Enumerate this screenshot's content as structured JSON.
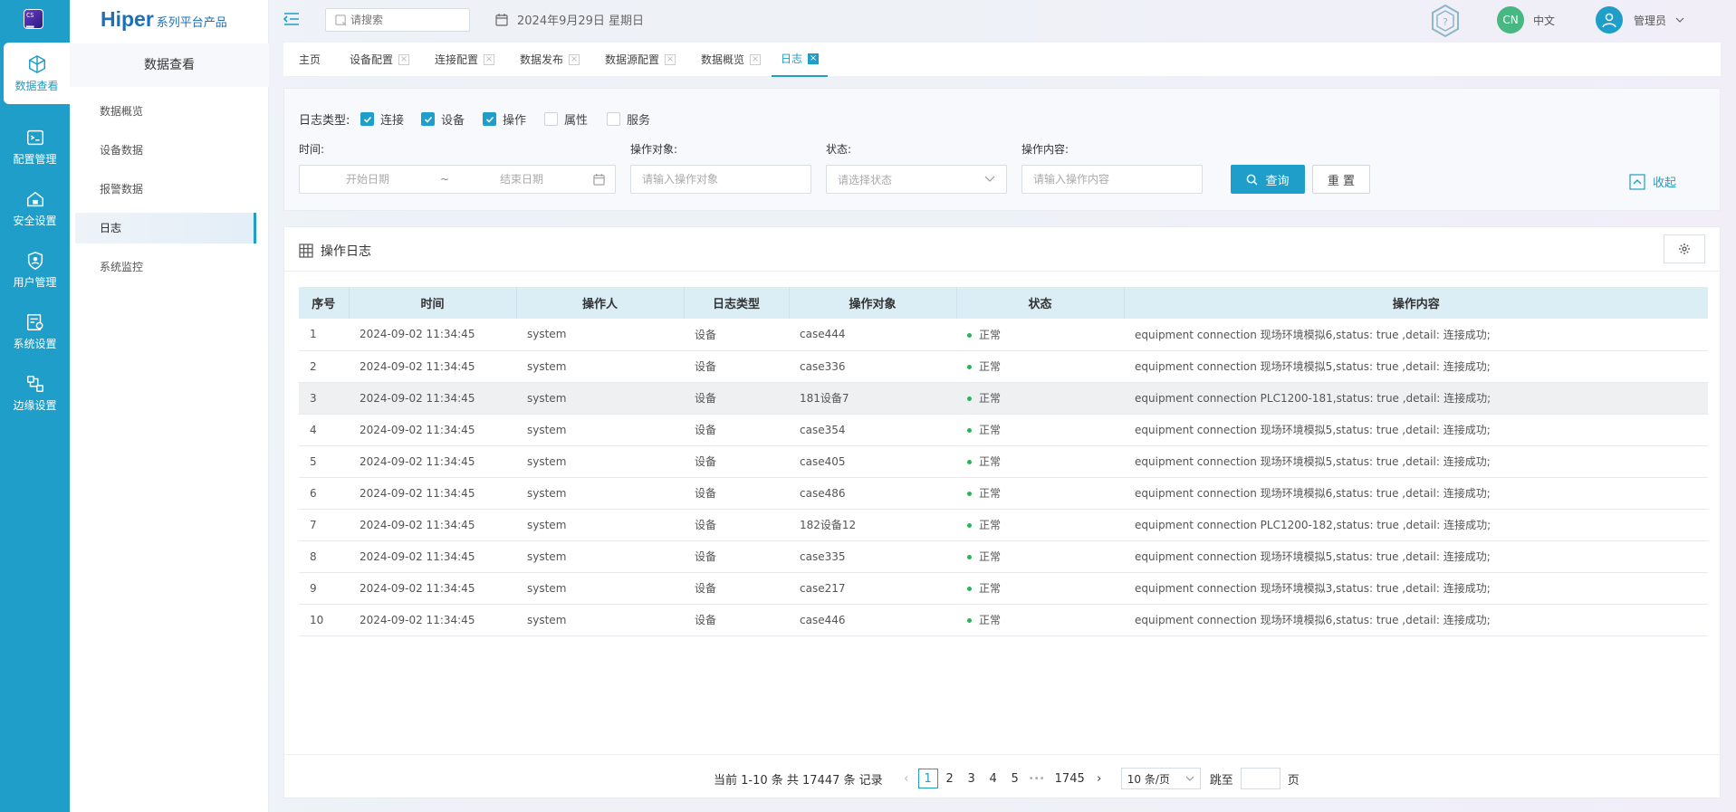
{
  "rail": {
    "items": [
      {
        "label": "数据查看",
        "icon": "cube-icon"
      },
      {
        "label": "配置管理",
        "icon": "cli-icon"
      },
      {
        "label": "安全设置",
        "icon": "house-lock-icon"
      },
      {
        "label": "用户管理",
        "icon": "shield-user-icon"
      },
      {
        "label": "系统设置",
        "icon": "settings-panel-icon"
      },
      {
        "label": "边缘设置",
        "icon": "edge-nodes-icon"
      }
    ]
  },
  "brand": {
    "name": "Hiper",
    "subtitle": "系列平台产品"
  },
  "sidebar": {
    "title": "数据查看",
    "items": [
      {
        "label": "数据概览"
      },
      {
        "label": "设备数据"
      },
      {
        "label": "报警数据"
      },
      {
        "label": "日志"
      },
      {
        "label": "系统监控"
      }
    ]
  },
  "header": {
    "search_placeholder": "请搜索",
    "date": "2024年9月29日 星期日",
    "lang_badge": "CN",
    "lang_label": "中文",
    "user": "管理员"
  },
  "tabs": [
    {
      "label": "主页"
    },
    {
      "label": "设备配置"
    },
    {
      "label": "连接配置"
    },
    {
      "label": "数据发布"
    },
    {
      "label": "数据源配置"
    },
    {
      "label": "数据概览"
    },
    {
      "label": "日志"
    }
  ],
  "filter": {
    "log_type_label": "日志类型:",
    "log_types": [
      {
        "label": "连接",
        "checked": true
      },
      {
        "label": "设备",
        "checked": true
      },
      {
        "label": "操作",
        "checked": true
      },
      {
        "label": "属性",
        "checked": false
      },
      {
        "label": "服务",
        "checked": false
      }
    ],
    "time_label": "时间:",
    "start_placeholder": "开始日期",
    "range_sep": "~",
    "end_placeholder": "结束日期",
    "target_label": "操作对象:",
    "target_placeholder": "请输入操作对象",
    "status_label": "状态:",
    "status_placeholder": "请选择状态",
    "content_label": "操作内容:",
    "content_placeholder": "请输入操作内容",
    "query_btn": "查询",
    "reset_btn": "重 置",
    "collapse": "收起"
  },
  "table": {
    "title": "操作日志",
    "columns": [
      "序号",
      "时间",
      "操作人",
      "日志类型",
      "操作对象",
      "状态",
      "操作内容"
    ],
    "rows": [
      [
        "1",
        "2024-09-02 11:34:45",
        "system",
        "设备",
        "case444",
        "正常",
        "equipment connection 现场环境模拟6,status: true ,detail: 连接成功;"
      ],
      [
        "2",
        "2024-09-02 11:34:45",
        "system",
        "设备",
        "case336",
        "正常",
        "equipment connection 现场环境模拟5,status: true ,detail: 连接成功;"
      ],
      [
        "3",
        "2024-09-02 11:34:45",
        "system",
        "设备",
        "181设备7",
        "正常",
        "equipment connection PLC1200-181,status: true ,detail: 连接成功;"
      ],
      [
        "4",
        "2024-09-02 11:34:45",
        "system",
        "设备",
        "case354",
        "正常",
        "equipment connection 现场环境模拟5,status: true ,detail: 连接成功;"
      ],
      [
        "5",
        "2024-09-02 11:34:45",
        "system",
        "设备",
        "case405",
        "正常",
        "equipment connection 现场环境模拟5,status: true ,detail: 连接成功;"
      ],
      [
        "6",
        "2024-09-02 11:34:45",
        "system",
        "设备",
        "case486",
        "正常",
        "equipment connection 现场环境模拟6,status: true ,detail: 连接成功;"
      ],
      [
        "7",
        "2024-09-02 11:34:45",
        "system",
        "设备",
        "182设备12",
        "正常",
        "equipment connection PLC1200-182,status: true ,detail: 连接成功;"
      ],
      [
        "8",
        "2024-09-02 11:34:45",
        "system",
        "设备",
        "case335",
        "正常",
        "equipment connection 现场环境模拟5,status: true ,detail: 连接成功;"
      ],
      [
        "9",
        "2024-09-02 11:34:45",
        "system",
        "设备",
        "case217",
        "正常",
        "equipment connection 现场环境模拟3,status: true ,detail: 连接成功;"
      ],
      [
        "10",
        "2024-09-02 11:34:45",
        "system",
        "设备",
        "case446",
        "正常",
        "equipment connection 现场环境模拟6,status: true ,detail: 连接成功;"
      ]
    ],
    "highlighted_row": 3
  },
  "pagination": {
    "summary": "当前 1-10 条 共 17447 条 记录",
    "pages": [
      "1",
      "2",
      "3",
      "4",
      "5"
    ],
    "ellipsis": "•••",
    "last_page": "1745",
    "page_size": "10 条/页",
    "jump_label": "跳至",
    "page_suffix": "页"
  },
  "colors": {
    "accent": "#1e9ec8",
    "ok": "#2bb35a",
    "lang": "#47b882"
  }
}
